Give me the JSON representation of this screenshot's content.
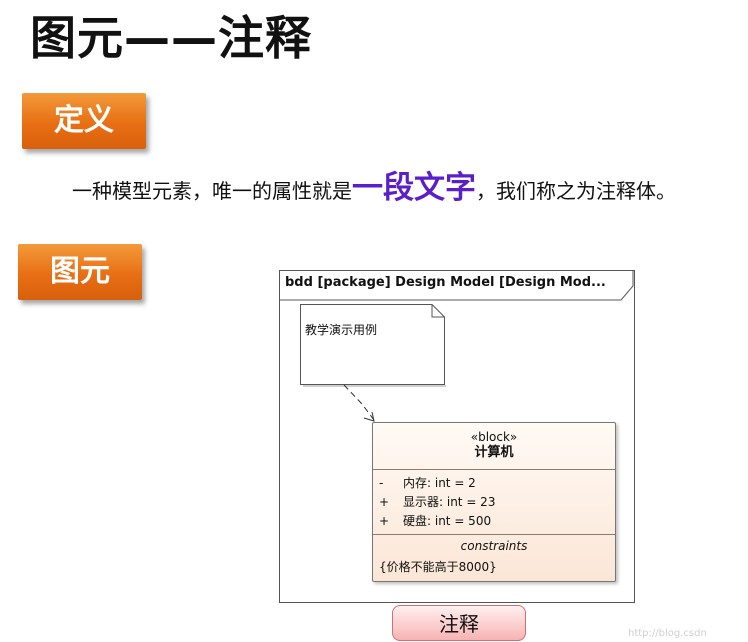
{
  "title": "图元——注释",
  "sections": {
    "definition_tag": "定义",
    "element_tag": "图元"
  },
  "definition": {
    "before": "一种模型元素，唯一的属性就是",
    "highlight": "一段文字",
    "after": "，我们称之为注释体。",
    "highlight_color": "#5a1fc7"
  },
  "diagram": {
    "frame_label": "bdd [package] Design Model [Design Mod...",
    "note_text": "教学演示用例",
    "block": {
      "stereotype": "«block»",
      "name": "计算机",
      "attributes": [
        {
          "visibility": "-",
          "text": "内存: int = 2"
        },
        {
          "visibility": "+",
          "text": "显示器: int = 23"
        },
        {
          "visibility": "+",
          "text": "硬盘: int = 500"
        }
      ],
      "constraints_title": "constraints",
      "constraint": "{价格不能高于8000}"
    }
  },
  "caption": "注释",
  "watermark": "http://blog.csdn"
}
